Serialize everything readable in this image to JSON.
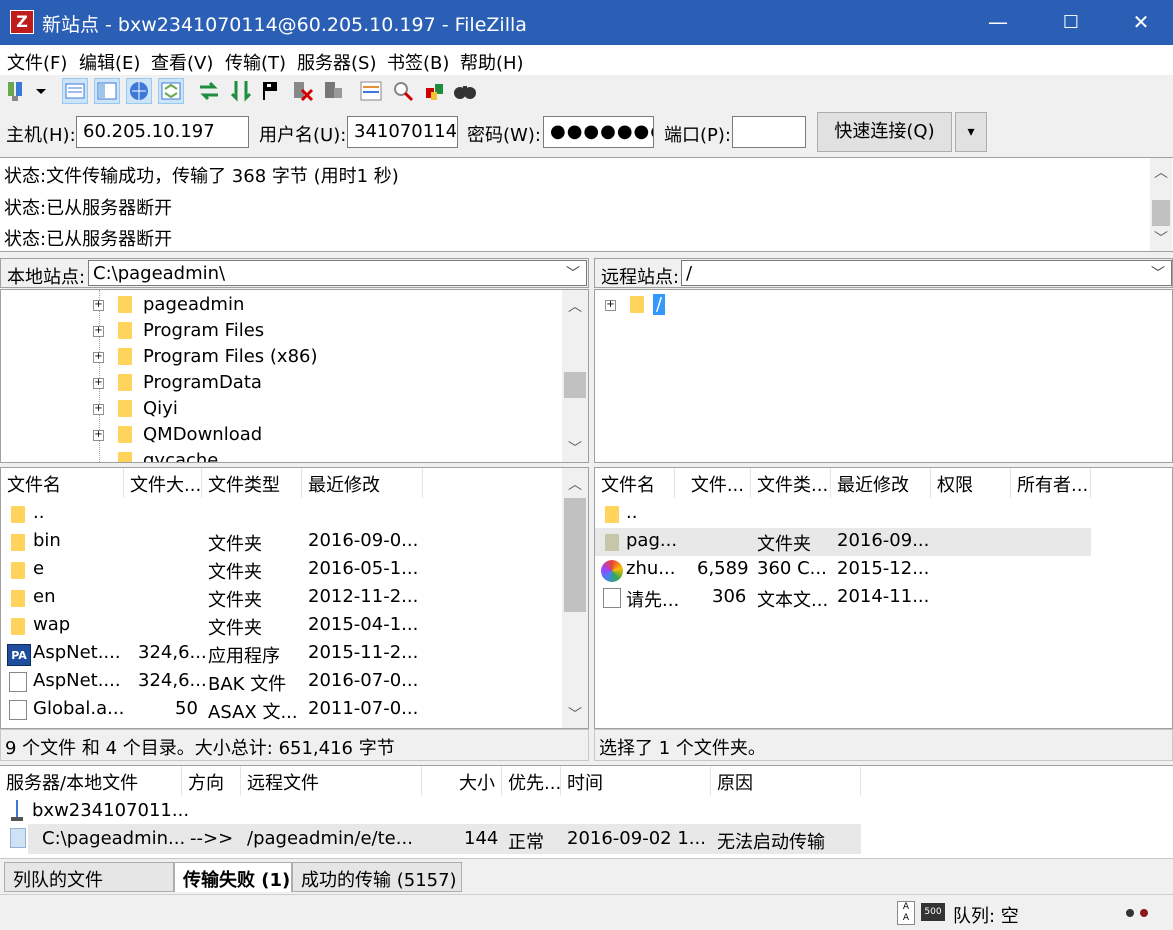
{
  "window": {
    "title": "新站点 - bxw2341070114@60.205.10.197 - FileZilla",
    "app_icon": "Z",
    "minimize_glyph": "—",
    "maximize_glyph": "☐",
    "close_glyph": "✕"
  },
  "menu": [
    "文件(F)",
    "编辑(E)",
    "查看(V)",
    "传输(T)",
    "服务器(S)",
    "书签(B)",
    "帮助(H)"
  ],
  "quickconnect": {
    "host_label": "主机(H):",
    "host_value": "60.205.10.197",
    "user_label": "用户名(U):",
    "user_value": "341070114",
    "pass_label": "密码(W):",
    "pass_value": "●●●●●●●●",
    "port_label": "端口(P):",
    "port_value": "",
    "connect_label": "快速连接(Q)",
    "dropdown_glyph": "▾"
  },
  "log": [
    "状态:文件传输成功，传输了 368 字节 (用时1 秒)",
    "状态:已从服务器断开",
    "状态:已从服务器断开"
  ],
  "local": {
    "site_label": "本地站点:",
    "path": "C:\\pageadmin\\",
    "tree": [
      "pageadmin",
      "Program Files",
      "Program Files (x86)",
      "ProgramData",
      "Qiyi",
      "QMDownload",
      "qycache"
    ],
    "columns": [
      "文件名",
      "文件大...",
      "文件类型",
      "最近修改"
    ],
    "rows": [
      {
        "name": "..",
        "size": "",
        "type": "",
        "modified": ""
      },
      {
        "name": "bin",
        "size": "",
        "type": "文件夹",
        "modified": "2016-09-0..."
      },
      {
        "name": "e",
        "size": "",
        "type": "文件夹",
        "modified": "2016-05-1..."
      },
      {
        "name": "en",
        "size": "",
        "type": "文件夹",
        "modified": "2012-11-2..."
      },
      {
        "name": "wap",
        "size": "",
        "type": "文件夹",
        "modified": "2015-04-1..."
      },
      {
        "name": "AspNet....",
        "size": "324,6...",
        "type": "应用程序",
        "modified": "2015-11-2..."
      },
      {
        "name": "AspNet....",
        "size": "324,6...",
        "type": "BAK 文件",
        "modified": "2016-07-0..."
      },
      {
        "name": "Global.a...",
        "size": "50",
        "type": "ASAX 文...",
        "modified": "2011-07-0..."
      }
    ],
    "status": "9 个文件 和 4 个目录。大小总计: 651,416 字节",
    "pa_badge": "PA"
  },
  "remote": {
    "site_label": "远程站点:",
    "path": "/",
    "tree": [
      "/"
    ],
    "columns": [
      "文件名",
      "文件...",
      "文件类...",
      "最近修改",
      "权限",
      "所有者..."
    ],
    "rows": [
      {
        "name": "..",
        "size": "",
        "type": "",
        "modified": ""
      },
      {
        "name": "pag...",
        "size": "",
        "type": "文件夹",
        "modified": "2016-09..."
      },
      {
        "name": "zhu...",
        "size": "6,589",
        "type": "360 C...",
        "modified": "2015-12..."
      },
      {
        "name": "请先...",
        "size": "306",
        "type": "文本文...",
        "modified": "2014-11..."
      }
    ],
    "status": "选择了 1 个文件夹。"
  },
  "queue": {
    "columns": [
      "服务器/本地文件",
      "方向",
      "远程文件",
      "大小",
      "优先...",
      "时间",
      "原因"
    ],
    "server": "bxw234107011...",
    "row": {
      "local": "C:\\pageadmin...",
      "dir": "-->>",
      "remote": "/pageadmin/e/te...",
      "size": "144",
      "priority": "正常",
      "time": "2016-09-02 1...",
      "reason": "无法启动传输"
    }
  },
  "tabs": [
    "列队的文件",
    "传输失败 (1)",
    "成功的传输 (5157)"
  ],
  "statusbar": {
    "queue": "队列: 空",
    "speed_icon_text": "500"
  }
}
